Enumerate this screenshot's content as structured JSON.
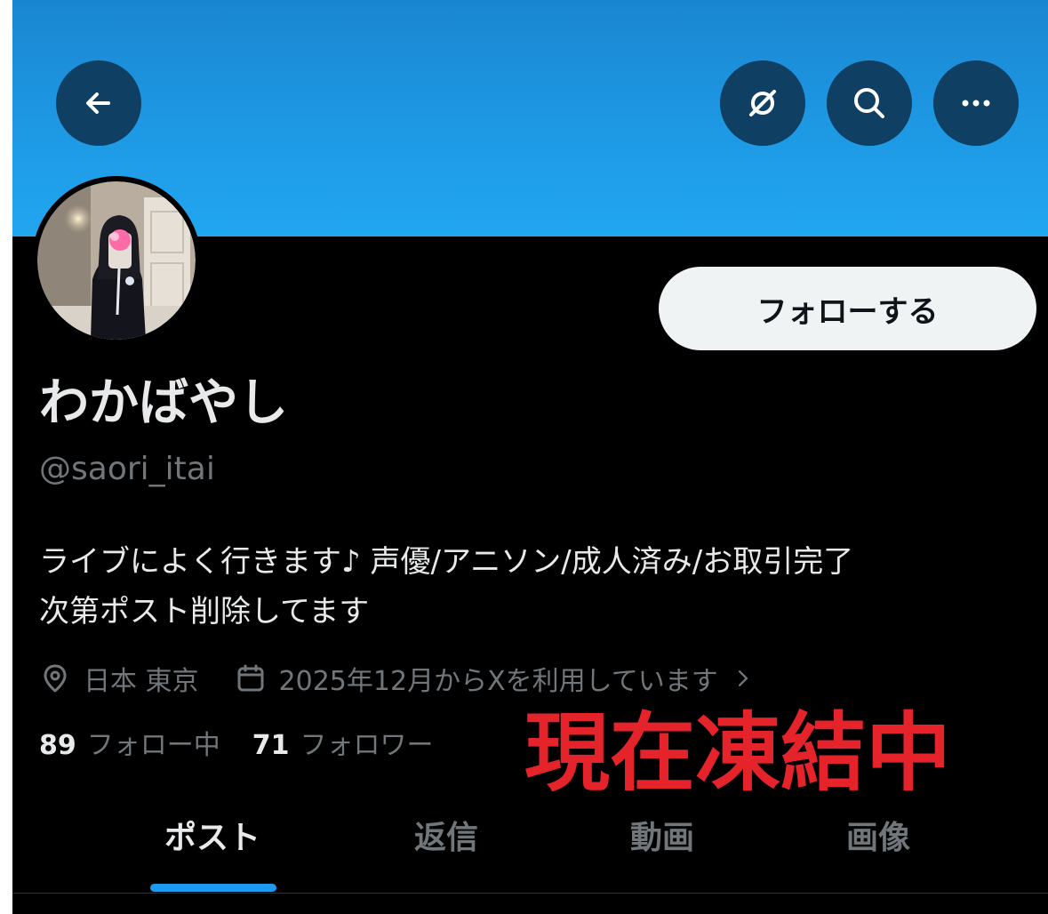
{
  "colors": {
    "banner": "#1e99e4",
    "button_bg": "#0f3f63",
    "follow_bg": "#eff3f4",
    "secondary_text": "#71767b",
    "accent": "#1d9bf0",
    "frozen_text": "#e5232b"
  },
  "header": {
    "back_icon": "arrow-left-icon",
    "grok_icon": "grok-icon",
    "search_icon": "search-icon",
    "more_icon": "more-horizontal-icon"
  },
  "profile": {
    "follow_label": "フォローする",
    "display_name": "わかばやし",
    "handle": "@saori_itai",
    "bio": "ライブによく行きます♪ 声優/アニソン/成人済み/お取引完了\n次第ポスト削除してます",
    "location": "日本 東京",
    "joined": "2025年12月からXを利用しています",
    "following_count": "89",
    "following_label": "フォロー中",
    "followers_count": "71",
    "followers_label": "フォロワー"
  },
  "overlay_text": "現在凍結中",
  "tabs": [
    {
      "label": "ポスト",
      "active": true
    },
    {
      "label": "返信",
      "active": false
    },
    {
      "label": "動画",
      "active": false
    },
    {
      "label": "画像",
      "active": false
    }
  ]
}
